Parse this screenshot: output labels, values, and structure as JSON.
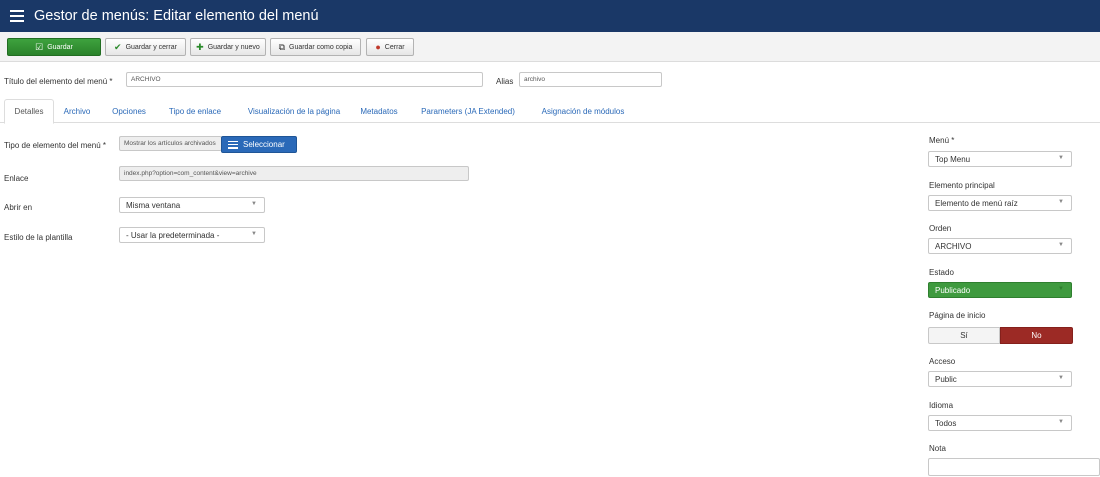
{
  "header": {
    "title": "Gestor de menús: Editar elemento del menú"
  },
  "toolbar": {
    "save": "Guardar",
    "save_close": "Guardar y cerrar",
    "save_new": "Guardar y nuevo",
    "save_copy": "Guardar como copia",
    "close": "Cerrar"
  },
  "title_row": {
    "title_label": "Título del elemento del menú *",
    "title_value": "ARCHIVO",
    "alias_label": "Alias",
    "alias_value": "archivo"
  },
  "tabs": [
    "Detalles",
    "Archivo",
    "Opciones",
    "Tipo de enlace",
    "Visualización de la página",
    "Metadatos",
    "Parameters (JA Extended)",
    "Asignación de módulos"
  ],
  "details": {
    "type_label": "Tipo de elemento del menú *",
    "type_value": "Mostrar los artículos archivados",
    "select_button": "Seleccionar",
    "link_label": "Enlace",
    "link_value": "index.php?option=com_content&view=archive",
    "open_label": "Abrir en",
    "open_value": "Misma ventana",
    "style_label": "Estilo de la plantilla",
    "style_value": "- Usar la predeterminada -"
  },
  "sidebar": {
    "menu_label": "Menú *",
    "menu_value": "Top Menu",
    "parent_label": "Elemento principal",
    "parent_value": "Elemento de menú raíz",
    "order_label": "Orden",
    "order_value": "ARCHIVO",
    "status_label": "Estado",
    "status_value": "Publicado",
    "home_label": "Página de inicio",
    "home_yes": "Sí",
    "home_no": "No",
    "access_label": "Acceso",
    "access_value": "Public",
    "language_label": "Idioma",
    "language_value": "Todos",
    "note_label": "Nota",
    "note_value": ""
  },
  "colors": {
    "header_bg": "#1a3867",
    "primary_green": "#2a822a",
    "link_blue": "#2a69b8",
    "status_green": "#3f9a3f",
    "toggle_no_red": "#9c2a25"
  }
}
